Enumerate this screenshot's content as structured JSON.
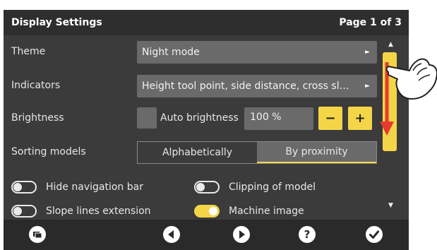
{
  "header": {
    "title": "Display Settings",
    "page": "Page 1 of 3"
  },
  "rows": {
    "theme": {
      "label": "Theme",
      "value": "Night mode"
    },
    "indicators": {
      "label": "Indicators",
      "value": "Height tool point, side distance, cross sl…"
    },
    "brightness": {
      "label": "Brightness",
      "auto_label": "Auto brightness",
      "auto_checked": false,
      "value": "100 %",
      "minus": "−",
      "plus": "+"
    },
    "sorting": {
      "label": "Sorting models",
      "options": [
        "Alphabetically",
        "By proximity"
      ],
      "selected": "By proximity"
    }
  },
  "toggles": [
    {
      "label": "Hide navigation bar",
      "on": false
    },
    {
      "label": "Clipping of model",
      "on": false
    },
    {
      "label": "Slope lines extension",
      "on": false
    },
    {
      "label": "Machine image",
      "on": true
    }
  ],
  "scroll": {
    "up": "▲",
    "down": "▼"
  },
  "select_arrow": "►",
  "bottom_bar": {
    "buttons": [
      "files-icon",
      "previous-icon",
      "next-icon",
      "help-icon",
      "confirm-icon"
    ]
  },
  "colors": {
    "background": "#3b3b3b",
    "header": "#2e2e2e",
    "control": "#6a6a6a",
    "accent": "#f4d548",
    "arrow": "#e63a2e"
  }
}
